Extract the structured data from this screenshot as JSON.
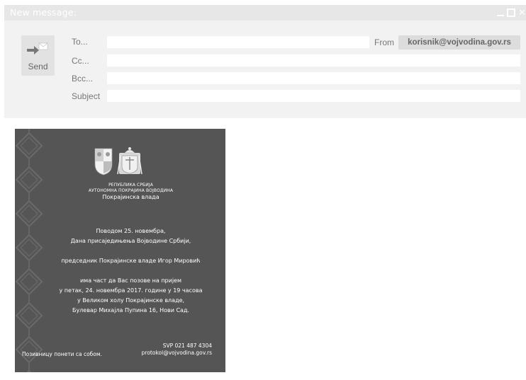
{
  "window": {
    "title": "New message:",
    "controls": [
      "minimize-icon",
      "maximize-icon",
      "close-icon"
    ]
  },
  "compose": {
    "send_label": "Send",
    "to_label": "To...",
    "cc_label": "Cc...",
    "bcc_label": "Bcc...",
    "subject_label": "Subject",
    "to_value": "",
    "cc_value": "",
    "bcc_value": "",
    "subject_value": "",
    "from_label": "From",
    "from_value": "korisnik@vojvodina.gov.rs"
  },
  "invitation": {
    "republic": "РЕПУБЛИКА СРБИЈА",
    "province": "АУТОНОМНА ПОКРАЈИНА ВОЈВОДИНА",
    "government": "Покрајинска влада",
    "occasion_line1": "Поводом 25. новембра,",
    "occasion_line2": "Дана присаједињења Војводине Србији,",
    "host": "председник Покрајинске владе Игор Мировић",
    "invite_line1": "има част да Вас позове на пријем",
    "invite_line2": "у петак, 24. новембра 2017. године у 19 часова",
    "invite_line3": "у Великом холу Покрајинске владе,",
    "invite_line4": "Булевар Михајла Пупина 16, Нови Сад.",
    "note": "Позивницу понети са собом.",
    "rsvp": "SVP 021 487 4304",
    "email": "protokol@vojvodina.gov.rs"
  },
  "colors": {
    "header_bg": "#f1f2f1",
    "titlebar_bg": "#e7e7e7",
    "card_bg": "#555555"
  }
}
